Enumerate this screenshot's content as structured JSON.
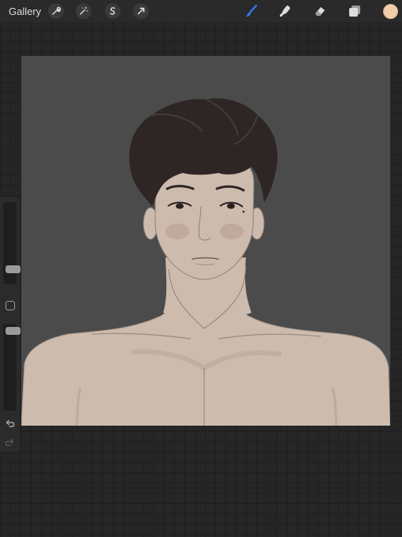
{
  "app": {
    "gallery_label": "Gallery"
  },
  "toolbar": {
    "left_tools": [
      "wrench-icon",
      "magic-wand-icon",
      "selection-icon",
      "transform-arrow-icon"
    ],
    "right_tools": [
      "brush-icon",
      "smudge-icon",
      "eraser-icon",
      "layers-icon"
    ],
    "active_tool": "brush-icon",
    "active_color": "#f1cda9",
    "accent_color": "#2f7cf6"
  },
  "sidebar": {
    "brush_size_level": 0.58,
    "opacity_level": 0.12,
    "undo_icon": "undo-icon",
    "redo_icon": "redo-icon"
  },
  "canvas": {
    "background_color": "#4b4b4b",
    "skin_color": "#cdbbad",
    "hair_color": "#2e2624"
  }
}
